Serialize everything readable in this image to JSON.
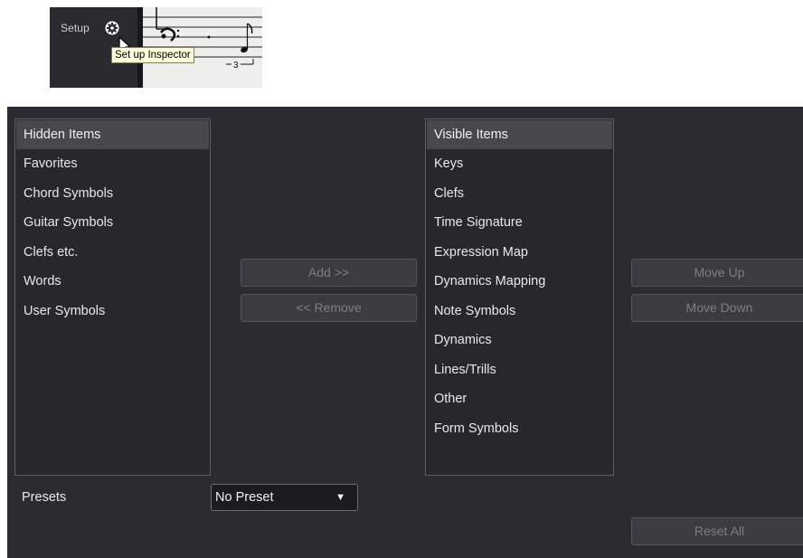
{
  "snippet": {
    "setup_label": "Setup",
    "gear_icon": "gear-icon",
    "tooltip": "Set up Inspector",
    "tuplet_number": "3"
  },
  "hidden_list": {
    "header": "Hidden Items",
    "items": [
      "Favorites",
      "Chord Symbols",
      "Guitar Symbols",
      "Clefs etc.",
      "Words",
      "User Symbols"
    ]
  },
  "visible_list": {
    "header": "Visible Items",
    "items": [
      "Keys",
      "Clefs",
      "Time Signature",
      "Expression Map",
      "Dynamics Mapping",
      "Note Symbols",
      "Dynamics",
      "Lines/Trills",
      "Other",
      "Form Symbols"
    ]
  },
  "buttons": {
    "add": "Add >>",
    "remove": "<< Remove",
    "move_up": "Move Up",
    "move_down": "Move Down",
    "reset_all": "Reset All"
  },
  "presets": {
    "label": "Presets",
    "selected": "No Preset",
    "caret_icon": "caret-down-icon"
  },
  "colors": {
    "panel_bg": "#2b2c30",
    "header_bg": "#46484d",
    "tooltip_bg": "#fdfdda",
    "disabled_text": "#7d7f84"
  }
}
